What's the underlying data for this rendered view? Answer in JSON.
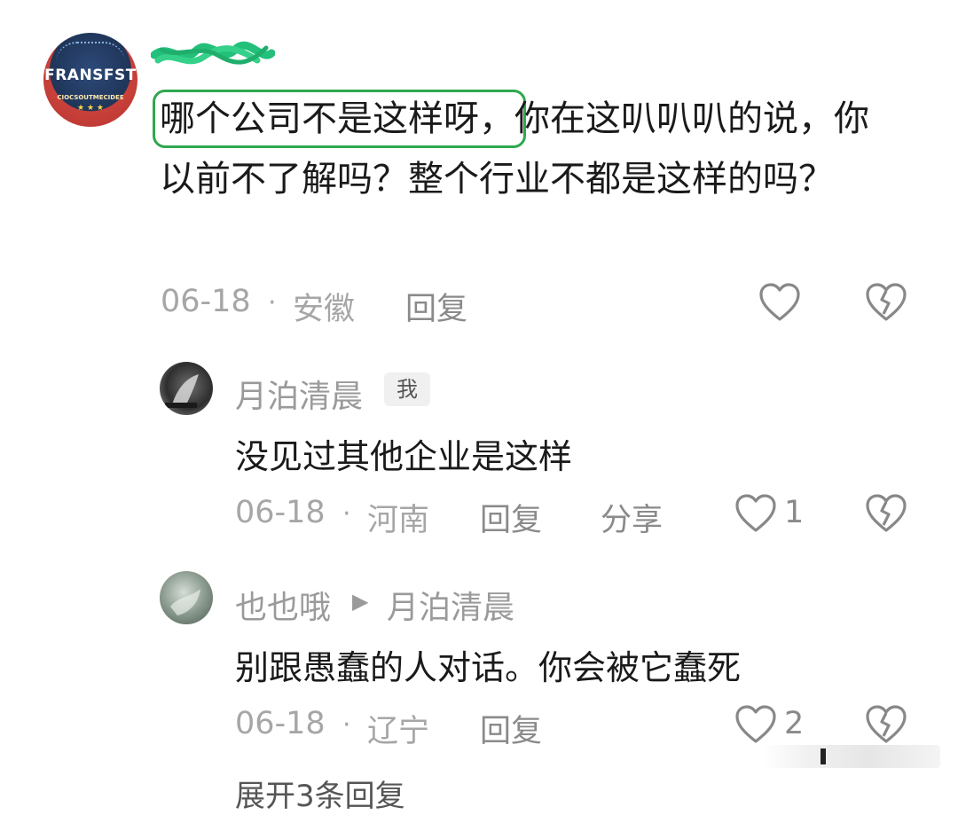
{
  "main_comment": {
    "text_highlight": "哪个公司不是这样呀",
    "text_rest": "，你在这叭叭叭的说，你以前不了解吗？整个行业不都是这样的吗？",
    "date": "06-18",
    "dot": "·",
    "location": "安徽",
    "reply_label": "回复",
    "avatar_text": "FRANSFST",
    "avatar_subtext": "CIOCSOUTMECIDEE",
    "highlight_color": "#2fa84f"
  },
  "reply1": {
    "name": "月泊清晨",
    "tag": "我",
    "text": "没见过其他企业是这样",
    "date": "06-18",
    "dot": "·",
    "location": "河南",
    "reply_label": "回复",
    "share_label": "分享",
    "like_count": "1"
  },
  "reply2": {
    "name": "也也哦",
    "arrow": "▶",
    "reply_to": "月泊清晨",
    "text": "别跟愚蠢的人对话。你会被它蠢死",
    "date": "06-18",
    "dot": "·",
    "location": "辽宁",
    "reply_label": "回复",
    "like_count": "2"
  },
  "more": {
    "expand_label": "展开3条回复"
  },
  "icons": {
    "like": "heart-icon",
    "dislike": "broken-heart-icon"
  }
}
